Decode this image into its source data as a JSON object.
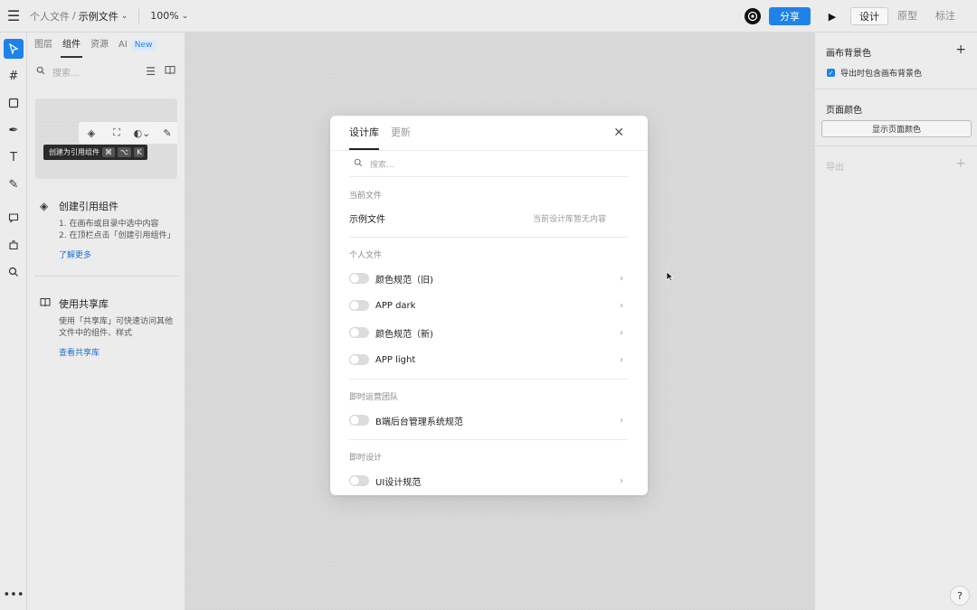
{
  "topbar": {
    "breadcrumb_parent": "个人文件",
    "breadcrumb_sep": "/",
    "file_name": "示例文件",
    "zoom": "100%",
    "avatar_icon": "team-avatar-icon",
    "share_label": "分享",
    "play_icon": "play-icon",
    "modes": [
      "设计",
      "原型",
      "标注"
    ],
    "active_mode": "设计"
  },
  "left_panel": {
    "tabs": [
      "图层",
      "组件",
      "资源",
      "AI"
    ],
    "active_tab": "组件",
    "new_badge": "New",
    "search_placeholder": "搜索...",
    "tooltip_text": "创建为引用组件",
    "tooltip_keys": [
      "⌘",
      "⌥",
      "K"
    ],
    "create_component": {
      "title": "创建引用组件",
      "text": "1. 在画布或目录中选中内容\n2. 在顶栏点击「创建引用组件」",
      "link": "了解更多"
    },
    "shared_library": {
      "title": "使用共享库",
      "text": "使用「共享库」可快速访问其他文件中的组件、样式",
      "link": "查看共享库"
    }
  },
  "right_panel": {
    "canvas_bg_title": "画布背景色",
    "export_with_bg_label": "导出时包含画布背景色",
    "export_with_bg_checked": true,
    "page_color_title": "页面颜色",
    "show_page_color_button": "显示页面颜色",
    "export_title": "导出",
    "help_label": "?"
  },
  "modal": {
    "tabs": [
      "设计库",
      "更新"
    ],
    "active_tab": "设计库",
    "search_placeholder": "搜索...",
    "current_file_section": "当前文件",
    "current_file_name": "示例文件",
    "current_file_note": "当前设计库暂无内容",
    "sections": [
      {
        "title": "个人文件",
        "items": [
          "颜色规范（旧)",
          "APP dark",
          "颜色规范（新)",
          "APP light"
        ]
      },
      {
        "title": "即时运营团队",
        "items": [
          "B端后台管理系统规范"
        ]
      },
      {
        "title": "即时设计",
        "items": [
          "UI设计规范"
        ]
      }
    ]
  },
  "colors": {
    "accent": "#1f82e8",
    "canvas": "#d9d9d9",
    "panel": "#ececec"
  }
}
